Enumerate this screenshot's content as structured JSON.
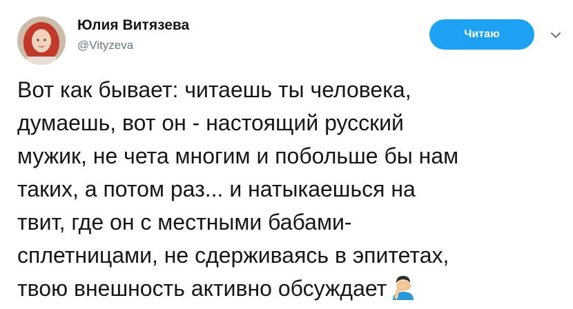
{
  "user": {
    "display_name": "Юлия Витязева",
    "handle": "@Vityzeva"
  },
  "follow_button": {
    "label": "Читаю"
  },
  "icons": {
    "avatar": "profile-photo",
    "menu": "chevron-down-icon",
    "emoji": "person-facepalming-emoji"
  },
  "tweet": {
    "text": "Вот как бывает: читаешь ты человека,\nдумаешь, вот он - настоящий русский\nмужик, не чета многим и побольше бы нам\nтаких, а потом раз... и натыкаешься на\nтвит, где он с местными бабами-\nсплетницами, не сдерживаясь в эпитетах,\nтвою внешность активно обсуждает"
  },
  "colors": {
    "accent": "#1da1f2",
    "text": "#14171a",
    "secondary": "#657786"
  }
}
